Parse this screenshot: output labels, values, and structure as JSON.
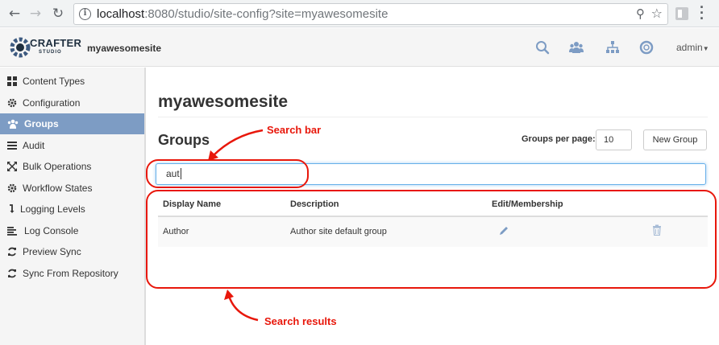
{
  "browser": {
    "url_host": "localhost",
    "url_rest": ":8080/studio/site-config?site=myawesomesite"
  },
  "header": {
    "logo_text": "CRAFTER",
    "logo_sub": "STUDIO",
    "site_name": "myawesomesite",
    "user_menu": "admin"
  },
  "sidebar": {
    "items": [
      {
        "label": "Content Types",
        "icon": "grid-icon"
      },
      {
        "label": "Configuration",
        "icon": "gear-icon"
      },
      {
        "label": "Groups",
        "icon": "users-icon",
        "active": true
      },
      {
        "label": "Audit",
        "icon": "list-icon"
      },
      {
        "label": "Bulk Operations",
        "icon": "expand-icon"
      },
      {
        "label": "Workflow States",
        "icon": "gear-icon"
      },
      {
        "label": "Logging Levels",
        "icon": "level-arrow-icon"
      },
      {
        "label": "Log Console",
        "icon": "align-left-icon"
      },
      {
        "label": "Preview Sync",
        "icon": "refresh-icon"
      },
      {
        "label": "Sync From Repository",
        "icon": "refresh-icon"
      }
    ]
  },
  "main": {
    "title": "myawesomesite",
    "heading": "Groups",
    "per_page_label": "Groups per page:",
    "per_page_value": "10",
    "new_group_label": "New Group",
    "search_value": "aut",
    "table": {
      "columns": [
        "Display Name",
        "Description",
        "Edit/Membership"
      ],
      "rows": [
        {
          "display_name": "Author",
          "description": "Author site default group"
        }
      ]
    }
  },
  "annotations": {
    "search_bar": "Search bar",
    "search_results": "Search results"
  },
  "colors": {
    "annotation_red": "#e8170b",
    "sidebar_active": "#7d9cc4",
    "icon_blue": "#7d9cc4"
  }
}
